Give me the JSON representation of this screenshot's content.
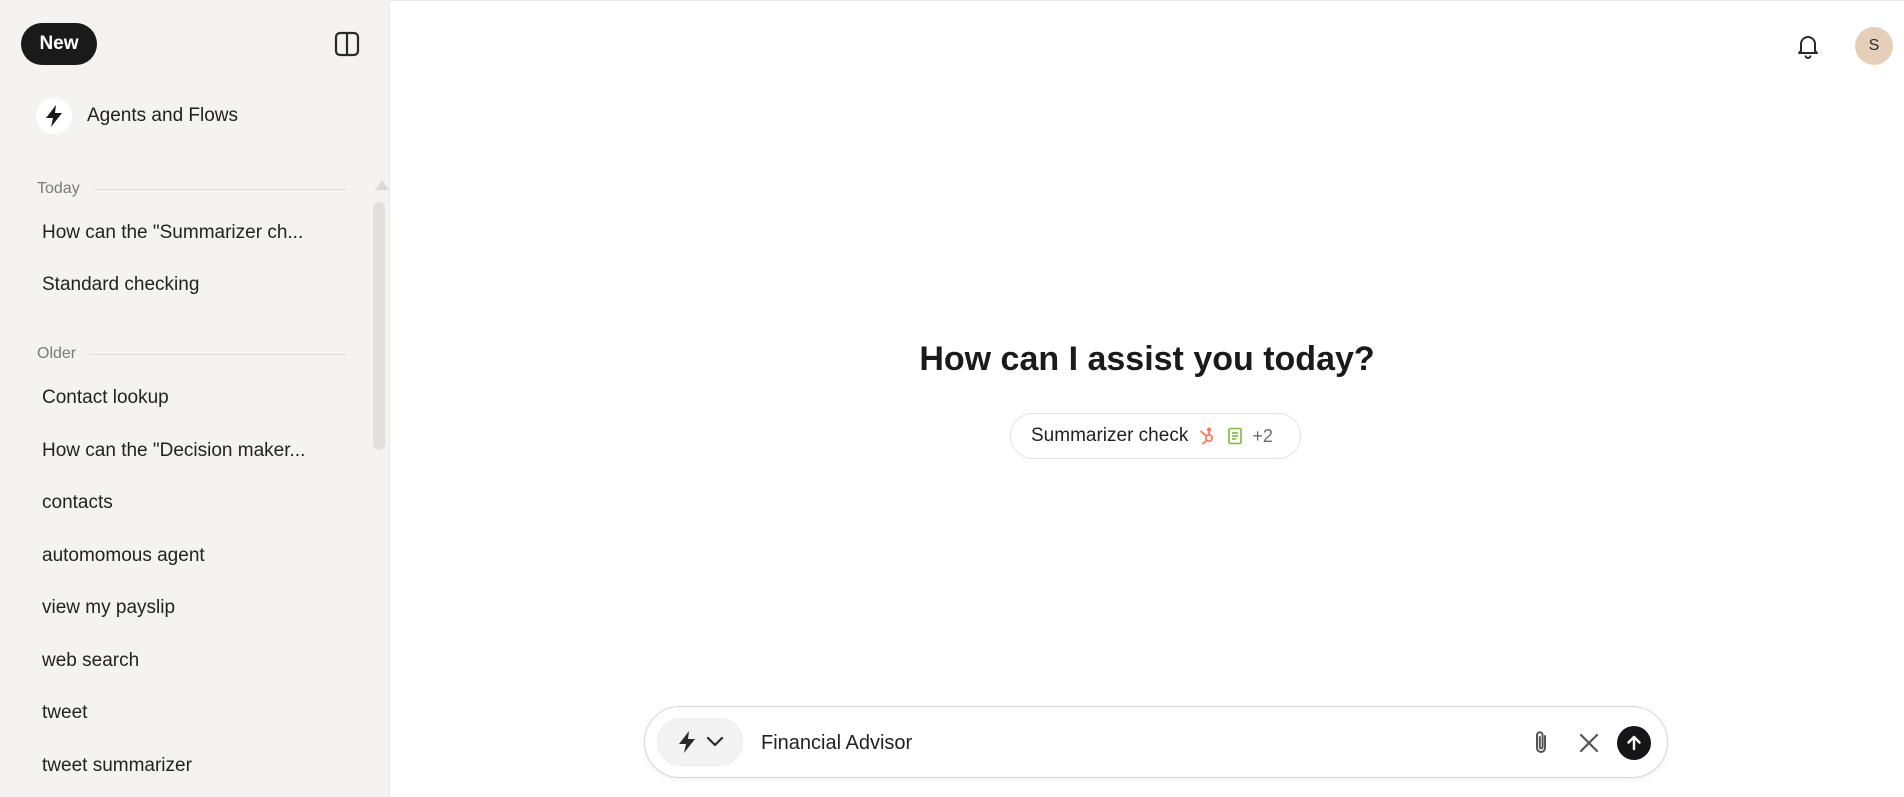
{
  "sidebar": {
    "new_label": "New",
    "agents_label": "Agents and Flows",
    "today_label": "Today",
    "older_label": "Older",
    "today_items": [
      "How can the \"Summarizer ch...",
      "Standard checking"
    ],
    "older_items": [
      "Contact lookup",
      "How can the \"Decision maker...",
      "contacts",
      "automomous agent",
      "view my payslip",
      "web search",
      "tweet",
      "tweet summarizer"
    ]
  },
  "header": {
    "avatar_initial": "S"
  },
  "main": {
    "headline": "How can I assist you today?",
    "chip": {
      "label": "Summarizer check",
      "more": "+2"
    }
  },
  "composer": {
    "value": "Financial Advisor",
    "placeholder": ""
  },
  "icons": {
    "bolt": "bolt-icon",
    "chevron": "chevron-down-icon",
    "bell": "bell-icon",
    "sidebar_toggle": "sidebar-toggle-icon",
    "attach": "paperclip-icon",
    "clear": "close-icon",
    "send": "arrow-up-icon",
    "hubspot": "hubspot-icon",
    "document": "document-icon"
  },
  "colors": {
    "sidebar_bg": "#f4f3f1",
    "primary_dark": "#1a1a1a",
    "avatar_bg": "#e6cfb8",
    "hubspot_orange": "#ff7a59",
    "doc_green": "#7dbb3c"
  }
}
